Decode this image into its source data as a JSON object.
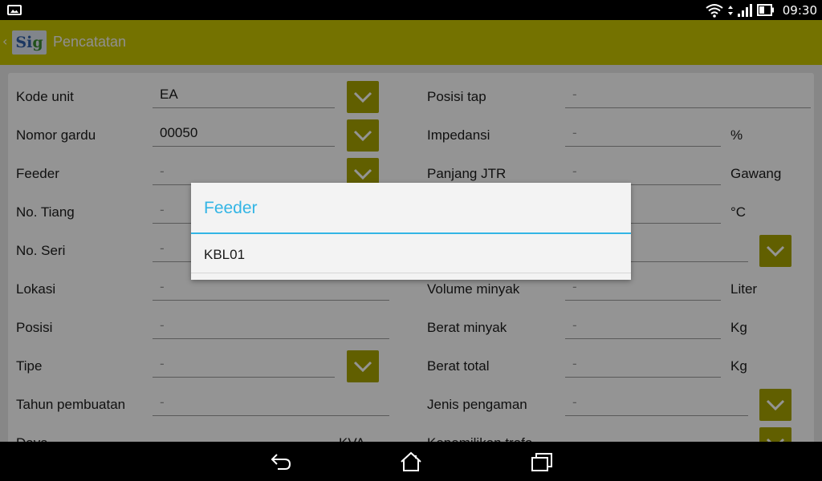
{
  "status_bar": {
    "time": "09:30",
    "icons": [
      "gallery-icon",
      "wifi-icon",
      "signal-icon",
      "battery-icon"
    ]
  },
  "action_bar": {
    "title": "Pencatatan",
    "logo_text_s": "S",
    "logo_text_i": "i",
    "logo_text_g": "g",
    "color": "#c8c400"
  },
  "form": {
    "left": [
      {
        "label": "Kode unit",
        "value": "EA",
        "dropdown": true
      },
      {
        "label": "Nomor gardu",
        "value": "00050",
        "dropdown": true
      },
      {
        "label": "Feeder",
        "value": "-",
        "dropdown": true
      },
      {
        "label": "No. Tiang",
        "value": "-",
        "dropdown": false
      },
      {
        "label": "No. Seri",
        "value": "-",
        "dropdown": false
      },
      {
        "label": "Lokasi",
        "value": "-",
        "dropdown": false
      },
      {
        "label": "Posisi",
        "value": "-",
        "dropdown": false
      },
      {
        "label": "Tipe",
        "value": "-",
        "dropdown": true
      },
      {
        "label": "Tahun pembuatan",
        "value": "-",
        "dropdown": false
      },
      {
        "label": "Daya",
        "value": "",
        "unit": "KVA",
        "dropdown": false
      }
    ],
    "right": [
      {
        "label": "Posisi tap",
        "value": "-",
        "unit": ""
      },
      {
        "label": "Impedansi",
        "value": "-",
        "unit": "%"
      },
      {
        "label": "Panjang JTR",
        "value": "-",
        "unit": "Gawang"
      },
      {
        "label": "",
        "value": "",
        "unit": "°C"
      },
      {
        "label": "",
        "value": "",
        "unit": "",
        "dropdown": true
      },
      {
        "label": "Volume minyak",
        "value": "-",
        "unit": "Liter"
      },
      {
        "label": "Berat minyak",
        "value": "-",
        "unit": "Kg"
      },
      {
        "label": "Berat total",
        "value": "-",
        "unit": "Kg"
      },
      {
        "label": "Jenis pengaman",
        "value": "-",
        "unit": "",
        "dropdown": true
      },
      {
        "label": "Kepemilikan trafo",
        "value": "",
        "unit": "",
        "dropdown": true
      }
    ]
  },
  "dialog": {
    "title": "Feeder",
    "items": [
      "KBL01"
    ],
    "accent": "#33b5e5"
  },
  "nav_bar": {
    "buttons": [
      "back-icon",
      "home-icon",
      "recents-icon"
    ]
  }
}
